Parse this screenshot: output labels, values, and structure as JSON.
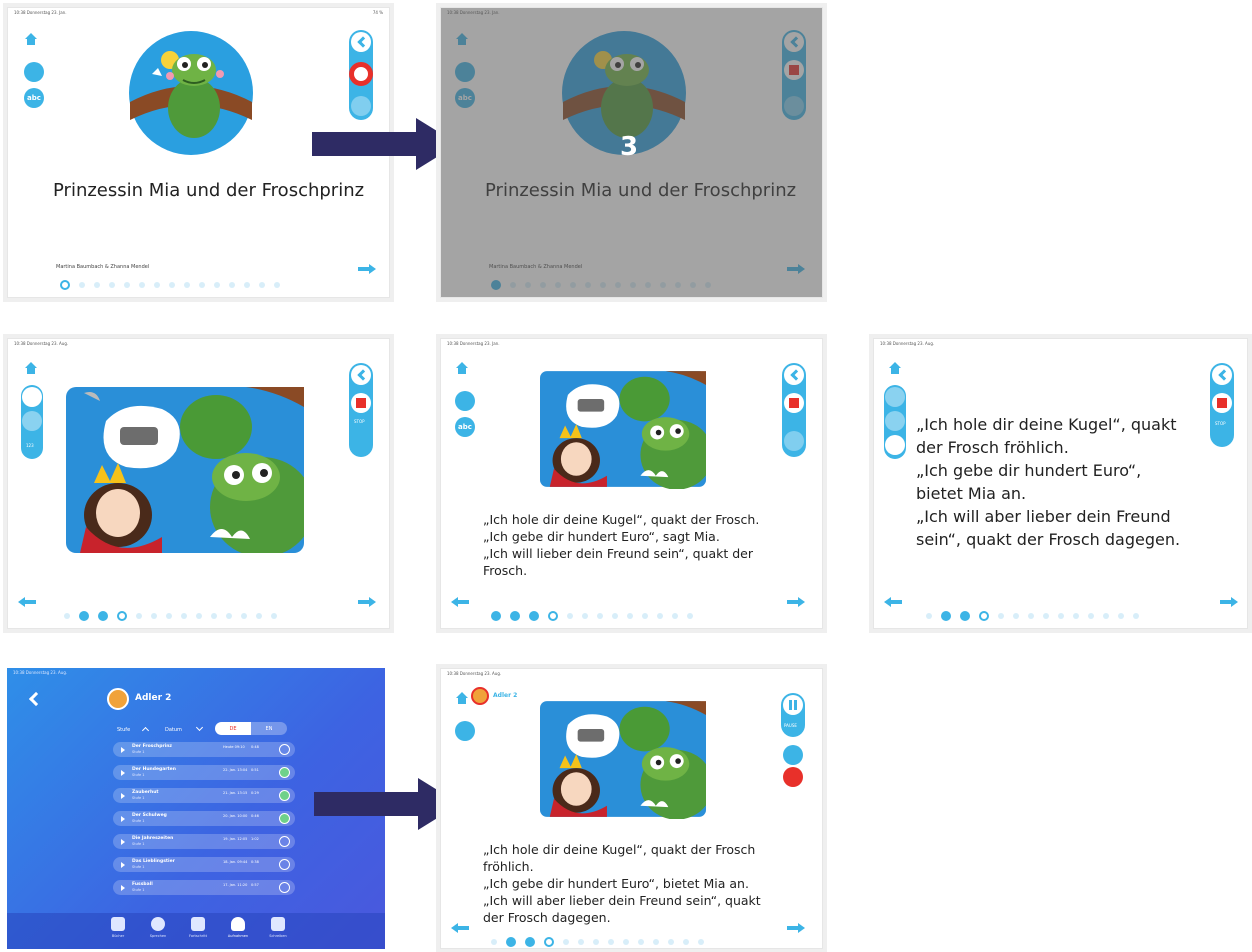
{
  "colors": {
    "accent": "#3cb4e6",
    "record": "#e8302a",
    "flow_arrow": "#2e2b64",
    "list_gradient_top": "#2f8fe8",
    "list_gradient_bottom": "#4a58dd"
  },
  "statusbar": {
    "p1": "10:38  Donnerstag 23. Jan.",
    "p1_right": "74 %",
    "p2": "10:38  Donnerstag 23. Jan.",
    "p3": "10:38  Donnerstag 23. Aug.",
    "p4": "10:38  Donnerstag 23. Jan.",
    "p5": "10:38  Donnerstag 23. Aug.",
    "p6": "10:38  Donnerstag 23. Aug.",
    "p7": "10:38  Donnerstag 23. Aug."
  },
  "book": {
    "title": "Prinzessin Mia und der Froschprinz",
    "authors": "Martina Baumbach & Zhanna Mendel"
  },
  "countdown": "3",
  "side": {
    "abc_label": "abc",
    "num_label": "123"
  },
  "page_text_small": "„Ich hole dir deine Kugel“, quakt der Frosch.\n„Ich gebe dir hundert Euro“, sagt Mia.\n„Ich will lieber dein Freund sein“, quakt der\nFrosch.",
  "page_text_big": "„Ich hole dir deine Kugel“, quakt\nder Frosch fröhlich.\n„Ich gebe dir hundert Euro“,\nbietet Mia an.\n„Ich will aber lieber dein Freund\nsein“, quakt der Frosch dagegen.",
  "page_text_final": "„Ich hole dir deine Kugel“, quakt der Frosch\nfröhlich.\n„Ich gebe dir hundert Euro“, bietet Mia an.\n„Ich will aber lieber dein Freund sein“, quakt\nder Frosch dagegen.",
  "user": {
    "name": "Adler 2"
  },
  "list": {
    "sort_label_1": "Stufe",
    "sort_label_2": "Datum",
    "seg": [
      "DE",
      "EN"
    ],
    "rows": [
      {
        "title": "Der Froschprinz",
        "sub": "Stufe 1",
        "date": "Heute 09:10",
        "len": "0:48"
      },
      {
        "title": "Der Hundegarten",
        "sub": "Stufe 1",
        "date": "22. Jan. 13:04",
        "len": "0:51"
      },
      {
        "title": "Zauberhut",
        "sub": "Stufe 1",
        "date": "21. Jan. 13:15",
        "len": "0:29"
      },
      {
        "title": "Der Schulweg",
        "sub": "Stufe 1",
        "date": "20. Jan. 10:00",
        "len": "0:46"
      },
      {
        "title": "Die Jahreszeiten",
        "sub": "Stufe 1",
        "date": "19. Jan. 12:05",
        "len": "1:02"
      },
      {
        "title": "Das Lieblingstier",
        "sub": "Stufe 1",
        "date": "18. Jan. 09:44",
        "len": "0:38"
      },
      {
        "title": "Fussball",
        "sub": "Stufe 1",
        "date": "17. Jan. 11:20",
        "len": "0:57"
      }
    ],
    "tabs": [
      "Bücher",
      "Sprechen",
      "Fortschritt",
      "Aufnahmen",
      "Schreiben"
    ]
  },
  "pause_label": "PAUSE",
  "mini_labels": {
    "stop": "STOP"
  }
}
